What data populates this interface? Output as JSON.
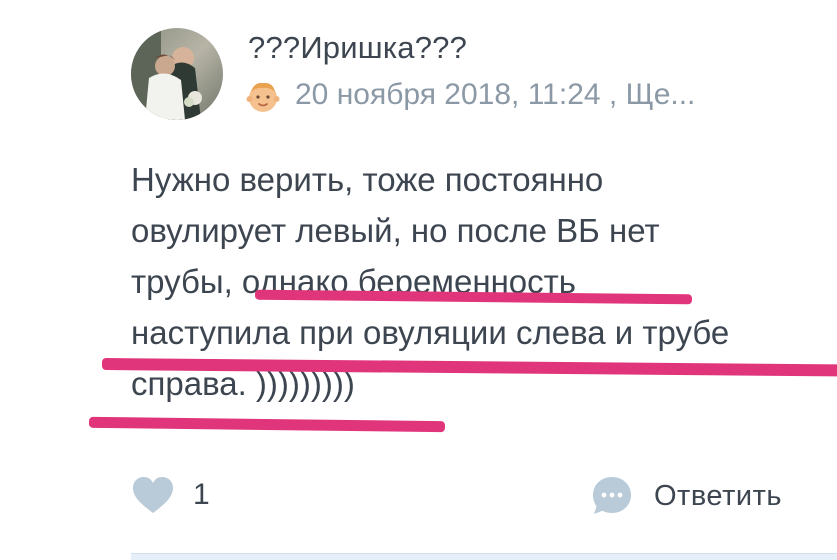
{
  "comment": {
    "author": {
      "name": "???Иришка???",
      "avatar": "avatar"
    },
    "status_icon": "baby-face-icon",
    "meta": "20 ноября 2018, 11:24 , Ще...",
    "text_lines": [
      "Нужно верить, тоже постоянно",
      "овулирует левый, но после ВБ нет",
      "трубы, однако беременность",
      "наступила при овуляции слева и трубе",
      "справа. )))))))))"
    ],
    "highlight_color": "#e0357a"
  },
  "actions": {
    "like_icon": "heart-icon",
    "like_count": "1",
    "reply_icon": "chat-bubble-icon",
    "reply_label": "Ответить"
  },
  "colors": {
    "text": "#3d4650",
    "meta": "#8b98a6",
    "icon": "#b9cbd8"
  }
}
